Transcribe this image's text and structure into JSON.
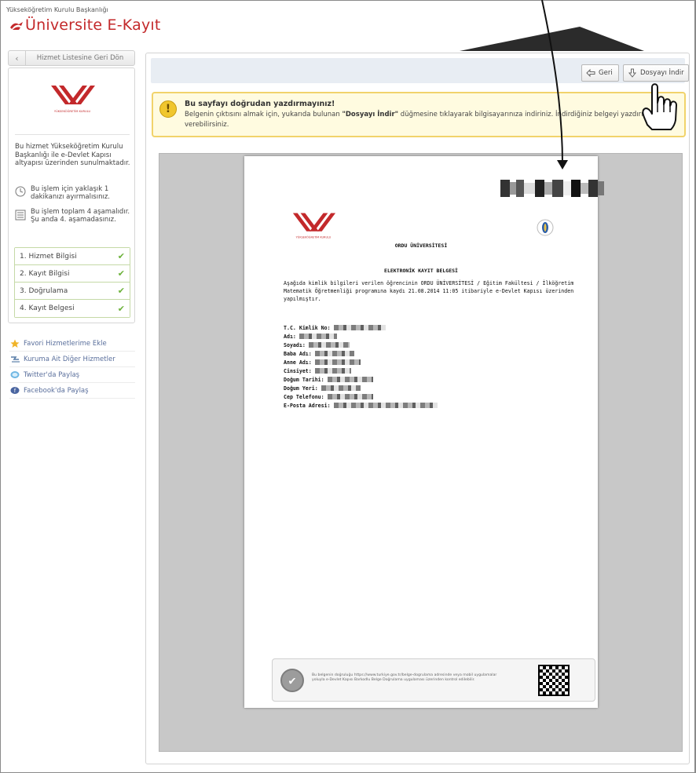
{
  "header": {
    "org": "Yükseköğretim Kurulu Başkanlığı",
    "title": "Üniversite E-Kayıt"
  },
  "left": {
    "back_label": "Hizmet Listesine Geri Dön",
    "logo_caption": "YÜKSEKÖĞRETİM KURULU",
    "info": "Bu hizmet Yükseköğretim Kurulu Başkanlığı ile e-Devlet Kapısı altyapısı üzerinden sunulmaktadır.",
    "time_note": "Bu işlem için yaklaşık 1 dakikanızı ayırmalısınız.",
    "steps_note": "Bu işlem toplam 4 aşamalıdır. Şu anda 4. aşamadasınız.",
    "steps": [
      {
        "label": "1. Hizmet Bilgisi"
      },
      {
        "label": "2. Kayıt Bilgisi"
      },
      {
        "label": "3. Doğrulama"
      },
      {
        "label": "4. Kayıt Belgesi"
      }
    ],
    "links": [
      {
        "label": "Favori Hizmetlerime Ekle",
        "icon": "star-icon"
      },
      {
        "label": "Kuruma Ait Diğer Hizmetler",
        "icon": "list-icon"
      },
      {
        "label": "Twitter'da Paylaş",
        "icon": "twitter-icon"
      },
      {
        "label": "Facebook'da Paylaş",
        "icon": "facebook-icon"
      }
    ]
  },
  "toolbar": {
    "back": "Geri",
    "download": "Dosyayı İndir"
  },
  "warning": {
    "title": "Bu sayfayı doğrudan yazdırmayınız!",
    "body_pre": "Belgenin çıktısını almak için, yukarıda bulunan ",
    "body_bold": "\"Dosyayı İndir\"",
    "body_post": " düğmesine tıklayarak bilgisayarınıza indiriniz. İndirdiğiniz belgeyi yazdırıp kuruma verebilirsiniz."
  },
  "document": {
    "logo_caption": "YÜKSEKÖĞRETİM KURULU",
    "university": "ORDU ÜNİVERSİTESİ",
    "doc_title": "ELEKTRONİK KAYIT BELGESİ",
    "body": "Aşağıda kimlik bilgileri verilen öğrencinin ORDU ÜNİVERSİTESİ / Eğitim Fakültesi / İlköğretim Matematik Öğretmenliği programına kaydı 21.08.2014 11:05 itibariyle e-Devlet Kapısı üzerinden yapılmıştır.",
    "fields": [
      {
        "label": "T.C. Kimlik No:"
      },
      {
        "label": "Adı:"
      },
      {
        "label": "Soyadı:"
      },
      {
        "label": "Baba Adı:"
      },
      {
        "label": "Anne Adı:"
      },
      {
        "label": "Cinsiyet:"
      },
      {
        "label": "Doğum Tarihi:"
      },
      {
        "label": "Doğum Yeri:"
      },
      {
        "label": "Cep Telefonu:"
      },
      {
        "label": "E-Posta Adresi:"
      }
    ],
    "verify_text": "Bu belgenin doğruluğu https://www.turkiye.gov.tr/belge-dogrulama adresinde veya mobil uygulamalar yoluyla e-Devlet Kapısı Barkodlu Belge Doğrulama uygulaması üzerinden kontrol edilebilir."
  },
  "colors": {
    "brand_red": "#c3292b",
    "warning_border": "#f1d36b",
    "step_check": "#6cb23a",
    "link": "#5a6f9c"
  }
}
